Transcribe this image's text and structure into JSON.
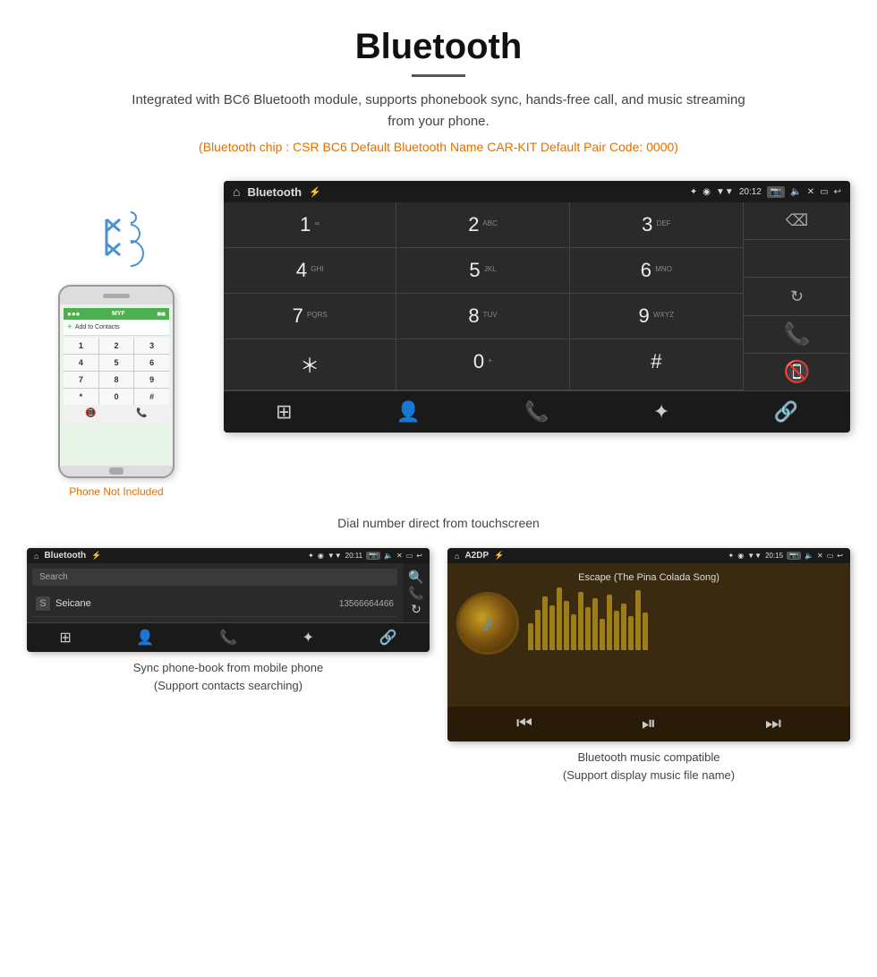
{
  "page": {
    "title": "Bluetooth",
    "description": "Integrated with BC6 Bluetooth module, supports phonebook sync, hands-free call, and music streaming from your phone.",
    "specs": "(Bluetooth chip : CSR BC6    Default Bluetooth Name CAR-KIT    Default Pair Code: 0000)",
    "dial_caption": "Dial number direct from touchscreen",
    "phonebook_caption": "Sync phone-book from mobile phone\n(Support contacts searching)",
    "music_caption": "Bluetooth music compatible\n(Support display music file name)"
  },
  "dialpad_screen": {
    "status_bar": {
      "title": "Bluetooth",
      "time": "20:12",
      "usb_icon": "⚡",
      "bt_icon": "✦",
      "location_icon": "◉",
      "signal_icon": "▼"
    },
    "keys": [
      {
        "num": "1",
        "letters": "∞"
      },
      {
        "num": "2",
        "letters": "ABC"
      },
      {
        "num": "3",
        "letters": "DEF"
      },
      {
        "num": "4",
        "letters": "GHI"
      },
      {
        "num": "5",
        "letters": "JKL"
      },
      {
        "num": "6",
        "letters": "MNO"
      },
      {
        "num": "7",
        "letters": "PQRS"
      },
      {
        "num": "8",
        "letters": "TUV"
      },
      {
        "num": "9",
        "letters": "WXYZ"
      },
      {
        "num": "*",
        "letters": ""
      },
      {
        "num": "0",
        "letters": "+"
      },
      {
        "num": "#",
        "letters": ""
      }
    ],
    "nav_icons": [
      "⊞",
      "👤",
      "📞",
      "✦",
      "🔗"
    ]
  },
  "phonebook_screen": {
    "status_bar": {
      "title": "Bluetooth",
      "time": "20:11"
    },
    "search_placeholder": "Search",
    "contacts": [
      {
        "letter": "S",
        "name": "Seicane",
        "number": "13566664466"
      }
    ]
  },
  "music_screen": {
    "status_bar": {
      "title": "A2DP",
      "time": "20:15"
    },
    "song_title": "Escape (The Pina Colada Song)",
    "eq_bars": [
      30,
      45,
      60,
      50,
      70,
      55,
      40,
      65,
      48,
      58,
      35,
      62,
      44,
      52,
      38,
      67,
      42
    ]
  },
  "phone_mockup": {
    "keys": [
      "1",
      "2",
      "3",
      "4",
      "5",
      "6",
      "7",
      "8",
      "9",
      "*",
      "0",
      "#"
    ],
    "not_included_label": "Phone Not Included"
  }
}
